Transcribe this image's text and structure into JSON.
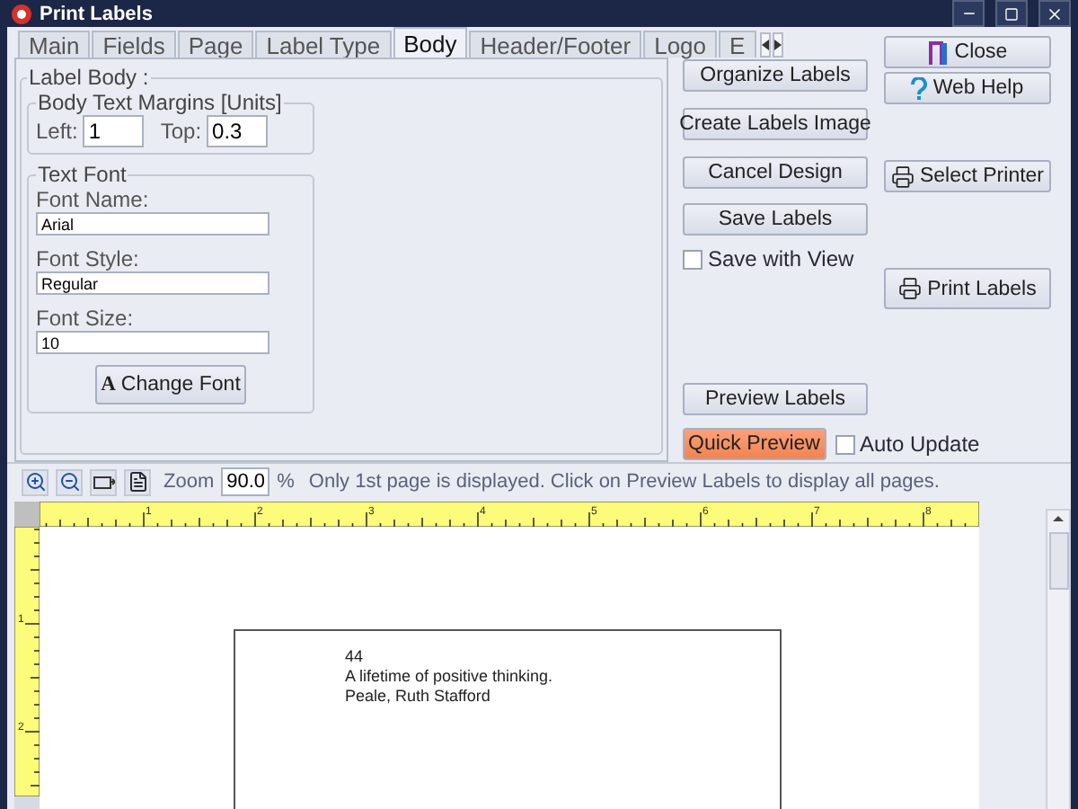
{
  "window": {
    "title": "Print Labels"
  },
  "tabs": [
    {
      "label": "Main",
      "selected": false
    },
    {
      "label": "Fields",
      "selected": false
    },
    {
      "label": "Page",
      "selected": false
    },
    {
      "label": "Label Type",
      "selected": false
    },
    {
      "label": "Body",
      "selected": true
    },
    {
      "label": "Header/Footer",
      "selected": false
    },
    {
      "label": "Logo",
      "selected": false
    },
    {
      "label": "E",
      "selected": false
    }
  ],
  "label_body": {
    "title": "Label Body :",
    "margins": {
      "title": "Body Text Margins [Units]",
      "left_label": "Left:",
      "left_value": "1",
      "top_label": "Top:",
      "top_value": "0.3"
    },
    "text_font": {
      "title": "Text Font",
      "fields": [
        {
          "label": "Font Name:",
          "value": "Arial"
        },
        {
          "label": "Font Style:",
          "value": "Regular"
        },
        {
          "label": "Font Size:",
          "value": "10"
        }
      ],
      "change_font": {
        "glyph": "A",
        "label": "Change Font"
      }
    }
  },
  "actions": {
    "left": [
      {
        "kind": "button",
        "label": "Organize Labels"
      },
      {
        "kind": "button",
        "label": "Create Labels Image"
      },
      {
        "kind": "button",
        "label": "Cancel Design"
      },
      {
        "kind": "button",
        "label": "Save Labels"
      },
      {
        "kind": "checkbox",
        "label": "Save with View",
        "checked": false
      },
      {
        "kind": "button",
        "label": "Preview Labels"
      }
    ],
    "quick_preview": {
      "label": "Quick Preview",
      "highlighted": true
    },
    "auto_update": {
      "label": "Auto Update",
      "checked": false
    },
    "right": [
      {
        "kind": "close",
        "label": "Close"
      },
      {
        "kind": "help",
        "label": "Web Help"
      },
      {
        "kind": "printer",
        "label": "Select Printer"
      },
      {
        "kind": "printer",
        "label": "Print Labels"
      }
    ]
  },
  "toolbar": {
    "zoom_label": "Zoom",
    "zoom_value": "90.0",
    "percent": "%",
    "message": "Only 1st page is displayed. Click on Preview Labels to display all pages."
  },
  "ruler": {
    "top_marks": [
      "1",
      "2",
      "3",
      "4",
      "5",
      "6",
      "7",
      "8"
    ],
    "left_marks": [
      "1",
      "2"
    ]
  },
  "label_preview": {
    "lines": [
      "44",
      "A lifetime of positive thinking.",
      "Peale, Ruth Stafford"
    ]
  }
}
